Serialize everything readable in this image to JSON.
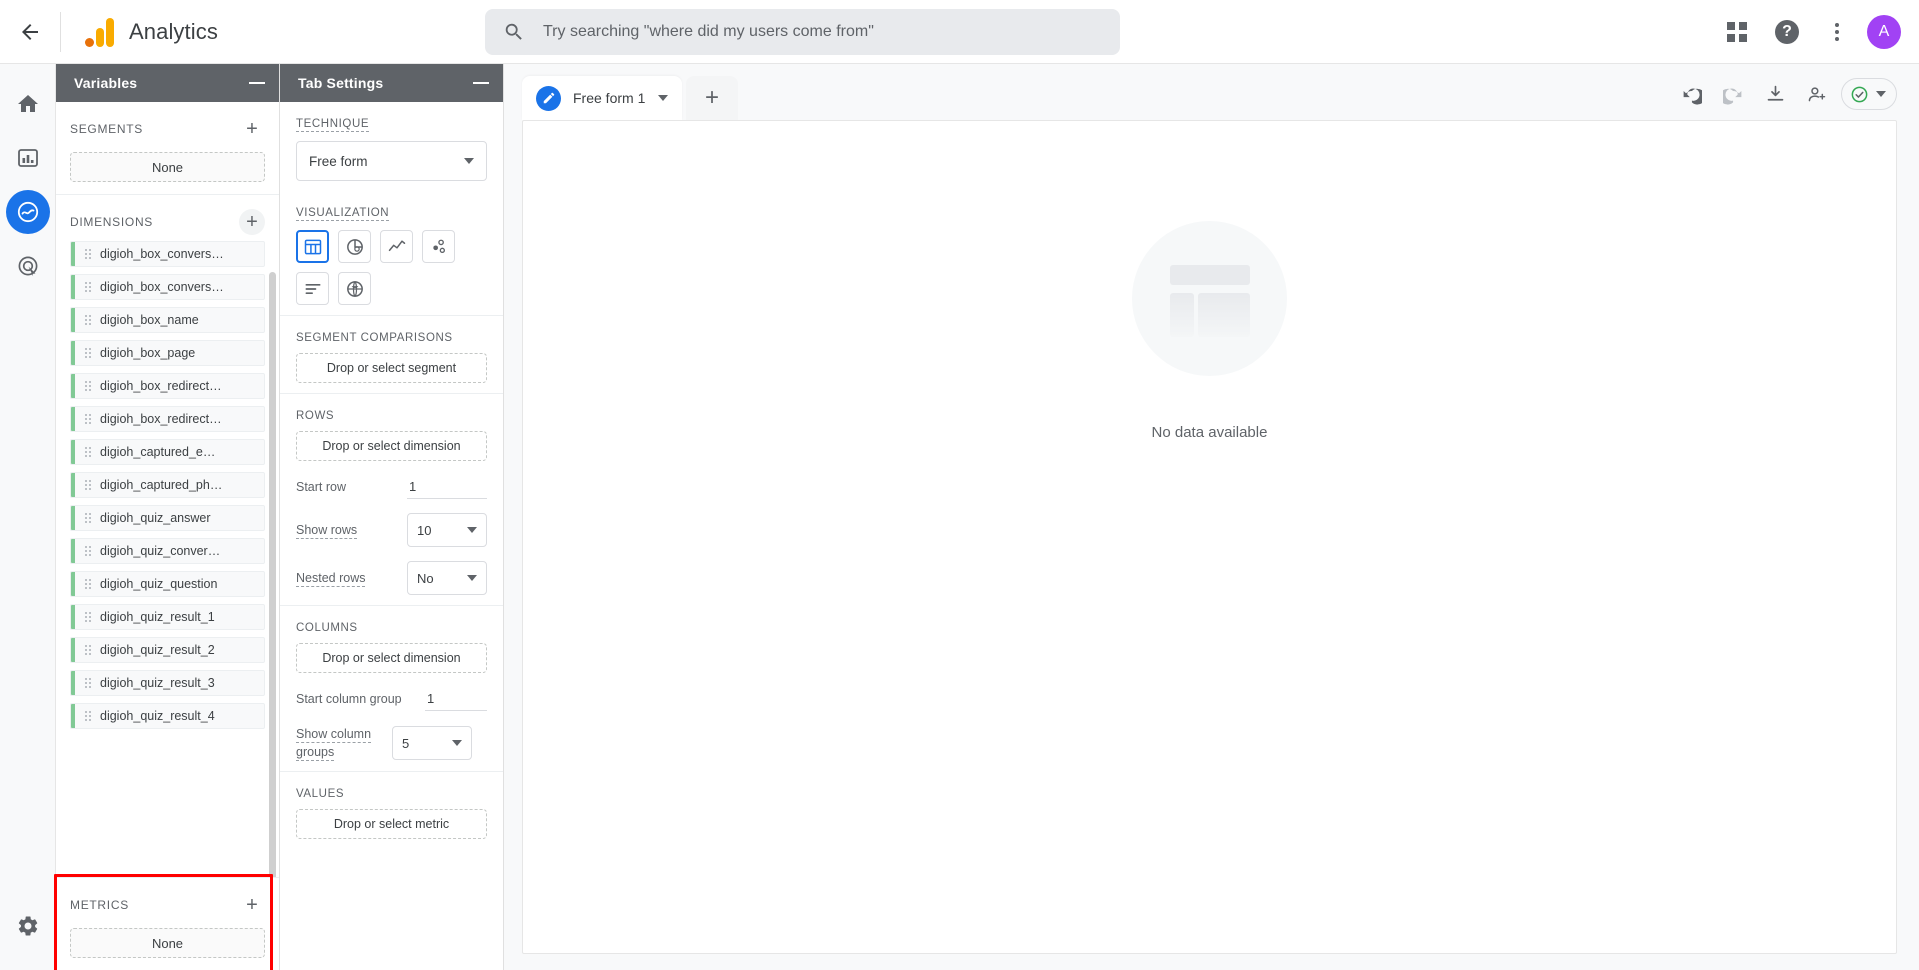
{
  "topbar": {
    "back_icon": "arrow-left-icon",
    "brand_title": "Analytics",
    "search_placeholder": "Try searching \"where did my users come from\"",
    "search_value": "",
    "search_icon": "search-icon",
    "apps_icon": "apps-grid-icon",
    "help_icon": "help-icon",
    "help_glyph": "?",
    "more_icon": "more-vertical-icon",
    "avatar_letter": "A",
    "avatar_color": "#A142F4"
  },
  "rail": {
    "items": [
      {
        "name": "home",
        "icon": "home-icon"
      },
      {
        "name": "reports",
        "icon": "bar-chart-icon"
      },
      {
        "name": "explore",
        "icon": "explore-icon",
        "active": true
      },
      {
        "name": "advertising",
        "icon": "target-icon"
      }
    ],
    "bottom": {
      "name": "admin",
      "icon": "gear-icon"
    }
  },
  "variables": {
    "title": "Variables",
    "minimize_icon": "minimize-icon",
    "segments": {
      "label": "SEGMENTS",
      "add_icon": "plus-icon",
      "empty_label": "None"
    },
    "dimensions": {
      "label": "DIMENSIONS",
      "add_icon": "plus-icon",
      "items": [
        "digioh_box_convers…",
        "digioh_box_convers…",
        "digioh_box_name",
        "digioh_box_page",
        "digioh_box_redirect…",
        "digioh_box_redirect…",
        "digioh_captured_e…",
        "digioh_captured_ph…",
        "digioh_quiz_answer",
        "digioh_quiz_conver…",
        "digioh_quiz_question",
        "digioh_quiz_result_1",
        "digioh_quiz_result_2",
        "digioh_quiz_result_3",
        "digioh_quiz_result_4"
      ],
      "chip_accent": "#81C995"
    },
    "metrics": {
      "label": "METRICS",
      "add_icon": "plus-icon",
      "empty_label": "None",
      "highlight_color": "#ff0000"
    }
  },
  "tab_settings": {
    "title": "Tab Settings",
    "minimize_icon": "minimize-icon",
    "technique": {
      "label": "TECHNIQUE",
      "value": "Free form",
      "caret_icon": "chevron-down-icon"
    },
    "visualization": {
      "label": "VISUALIZATION",
      "options": [
        {
          "name": "table",
          "icon": "table-icon",
          "selected": true
        },
        {
          "name": "donut",
          "icon": "donut-chart-icon",
          "selected": false
        },
        {
          "name": "line",
          "icon": "line-chart-icon",
          "selected": false
        },
        {
          "name": "scatter",
          "icon": "scatter-plot-icon",
          "selected": false
        },
        {
          "name": "bar",
          "icon": "bar-chart-horizontal-icon",
          "selected": false
        },
        {
          "name": "geo",
          "icon": "globe-icon",
          "selected": false
        }
      ],
      "selected_color": "#1a73e8"
    },
    "segment_comparisons": {
      "label": "SEGMENT COMPARISONS",
      "drop_label": "Drop or select segment"
    },
    "rows": {
      "label": "ROWS",
      "drop_label": "Drop or select dimension",
      "start_row_label": "Start row",
      "start_row_value": "1",
      "show_rows_label": "Show rows",
      "show_rows_value": "10",
      "nested_rows_label": "Nested rows",
      "nested_rows_value": "No"
    },
    "columns": {
      "label": "COLUMNS",
      "drop_label": "Drop or select dimension",
      "start_group_label": "Start column group",
      "start_group_value": "1",
      "show_groups_label": "Show column groups",
      "show_groups_value": "5"
    },
    "values": {
      "label": "VALUES",
      "drop_label": "Drop or select metric"
    }
  },
  "canvas": {
    "tab": {
      "label": "Free form 1",
      "icon": "edit-pencil-icon",
      "caret_icon": "chevron-down-icon"
    },
    "add_tab_label": "+",
    "tools": [
      {
        "name": "undo",
        "icon": "undo-icon"
      },
      {
        "name": "redo",
        "icon": "redo-icon"
      },
      {
        "name": "download",
        "icon": "download-icon"
      },
      {
        "name": "share",
        "icon": "share-user-icon"
      }
    ],
    "status": {
      "icon": "check-circle-icon",
      "color": "#34a853",
      "caret_icon": "chevron-down-icon"
    },
    "empty_state": {
      "icon": "empty-layout-icon",
      "text": "No data available"
    }
  }
}
